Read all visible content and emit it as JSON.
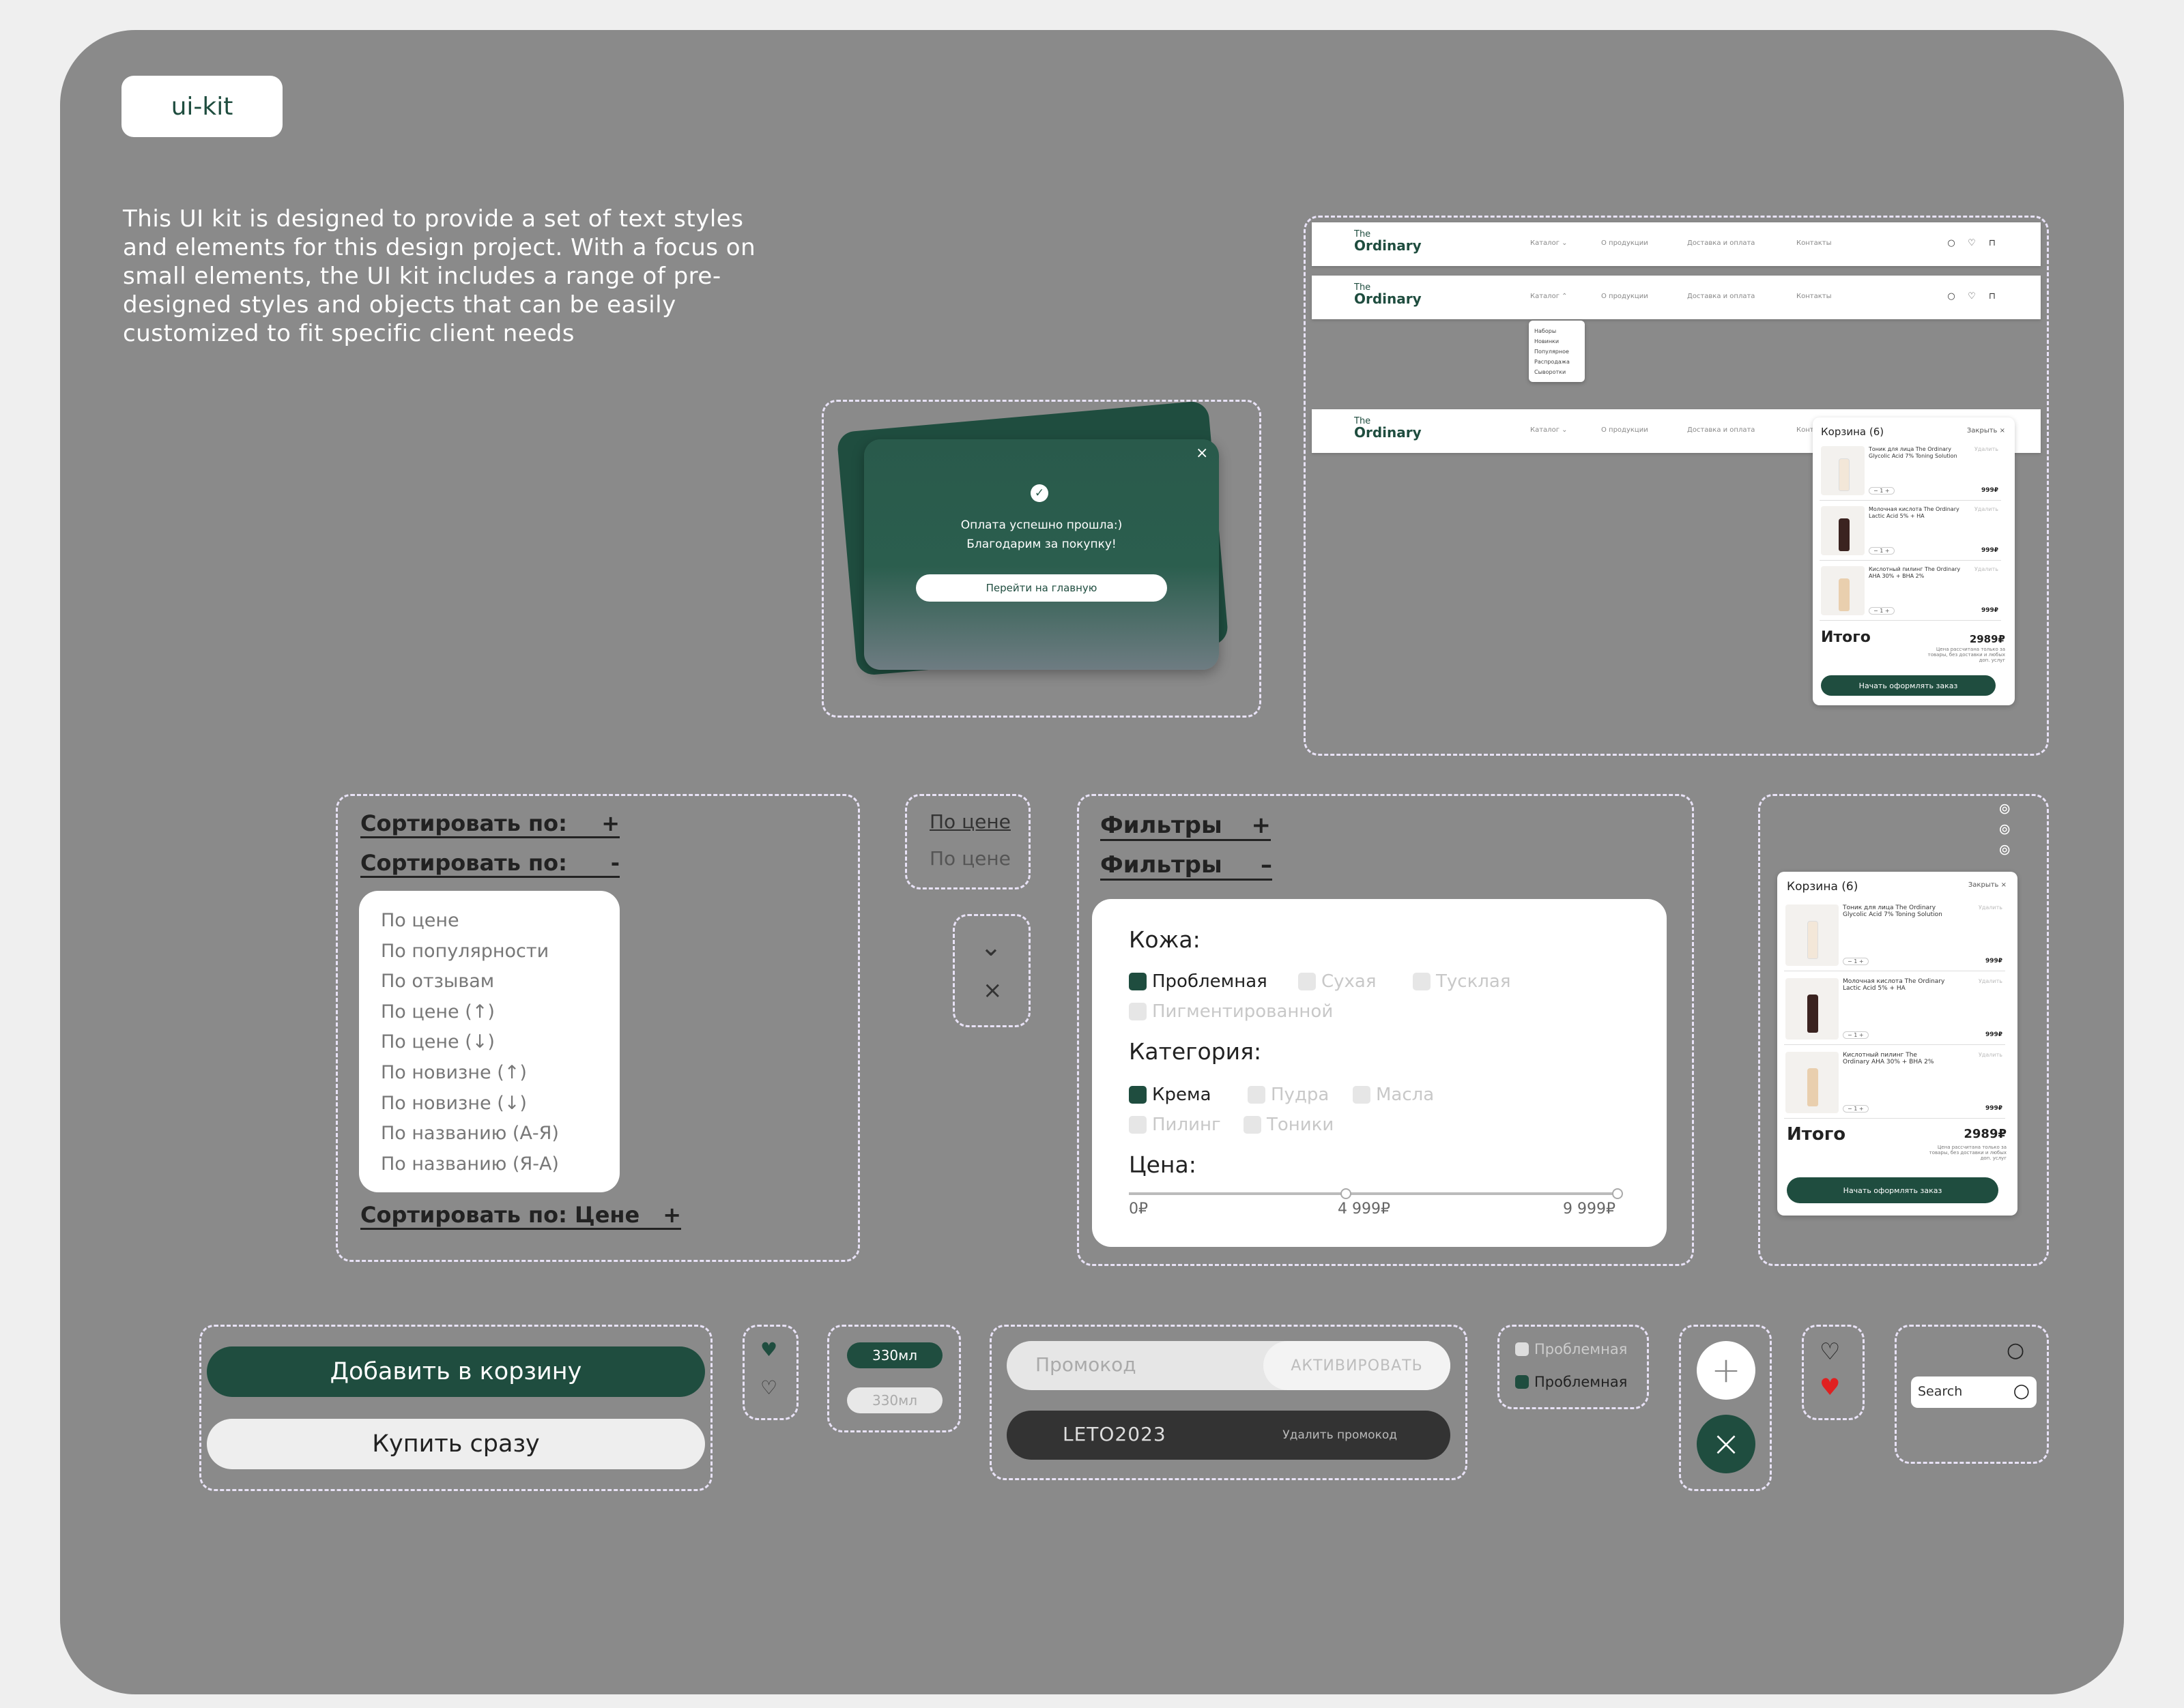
{
  "kit_label": "ui-kit",
  "intro": "This UI kit is designed to provide a set of text styles and elements for this design project. With a focus on small elements, the UI kit includes a range of pre-designed styles and objects that can be easily customized to fit specific client needs",
  "header": {
    "logo_top": "The",
    "logo_bottom": "Ordinary",
    "nav": [
      "Каталог ⌄",
      "О продукции",
      "Доставка и оплата",
      "Контакты"
    ],
    "nav_open": "Каталог ⌃",
    "dropdown": [
      "Наборы",
      "Новинки",
      "Популярное",
      "Распродажа",
      "Сыворотки"
    ],
    "nav_partial": "Конт"
  },
  "modal": {
    "line1": "Оплата успешно прошла:)",
    "line2": "Благодарим за покупку!",
    "button": "Перейти на главную",
    "close": "×",
    "check": "✓"
  },
  "cart": {
    "title": "Корзина (6)",
    "close": "Закрыть ×",
    "remove": "Удалить",
    "qty": "−  1  +",
    "items": [
      {
        "name": "Тоник для лица The Ordinary Glycolic Acid 7% Toning Solution",
        "price": "999₽"
      },
      {
        "name": "Молочная кислота The Ordinary Lactic Acid 5% + HA",
        "price": "999₽"
      },
      {
        "name": "Кислотный пилинг The Ordinary AHA 30% + BHA 2%",
        "price": "999₽"
      }
    ],
    "total_label": "Итого",
    "total": "2989₽",
    "note": "Цена рассчитана только за товары, без доставки и любых доп. услуг",
    "checkout": "Начать оформлять заказ"
  },
  "sort": {
    "label_plus": "Сортировать по:",
    "plus": "+",
    "label_minus": "Сортировать по:",
    "minus": "-",
    "options": [
      "По цене",
      "По популярности",
      "По отзывам",
      "По цене (↑)",
      "По цене (↓)",
      "По новизне (↑)",
      "По новизне (↓)",
      "По названию (А-Я)",
      "По названию (Я-А)"
    ],
    "selected_label": "Сортировать по: Цене"
  },
  "price_sort": {
    "active": "По цене",
    "inactive": "По цене"
  },
  "toggles": {
    "chevron": "⌄",
    "close": "×"
  },
  "filters": {
    "label_plus": "Фильтры",
    "plus": "+",
    "label_minus": "Фильтры",
    "minus": "–",
    "skin_title": "Кожа:",
    "skin": [
      "Проблемная",
      "Сухая",
      "Тусклая",
      "Пигментированной"
    ],
    "category_title": "Категория:",
    "category": [
      "Крема",
      "Пудра",
      "Масла",
      "Пилинг",
      "Тоники"
    ],
    "price_title": "Цена:",
    "price_min": "0₽",
    "price_mid": "4 999₽",
    "price_max": "9 999₽"
  },
  "buttons": {
    "add_to_cart": "Добавить в корзину",
    "buy_now": "Купить сразу"
  },
  "volume": {
    "active": "330мл",
    "inactive": "330мл"
  },
  "promo": {
    "placeholder": "Промокод",
    "activate": "АКТИВИРОВАТЬ",
    "code": "LETO2023",
    "remove": "Удалить промокод"
  },
  "checkbox": {
    "unchecked": "Проблемная",
    "checked": "Проблемная"
  },
  "round": {
    "add": "+",
    "close": "×"
  },
  "search": {
    "placeholder": "Search"
  },
  "colors": {
    "brand": "#1f4d3f",
    "board": "#8a8a8a",
    "heart": "#e02020"
  }
}
